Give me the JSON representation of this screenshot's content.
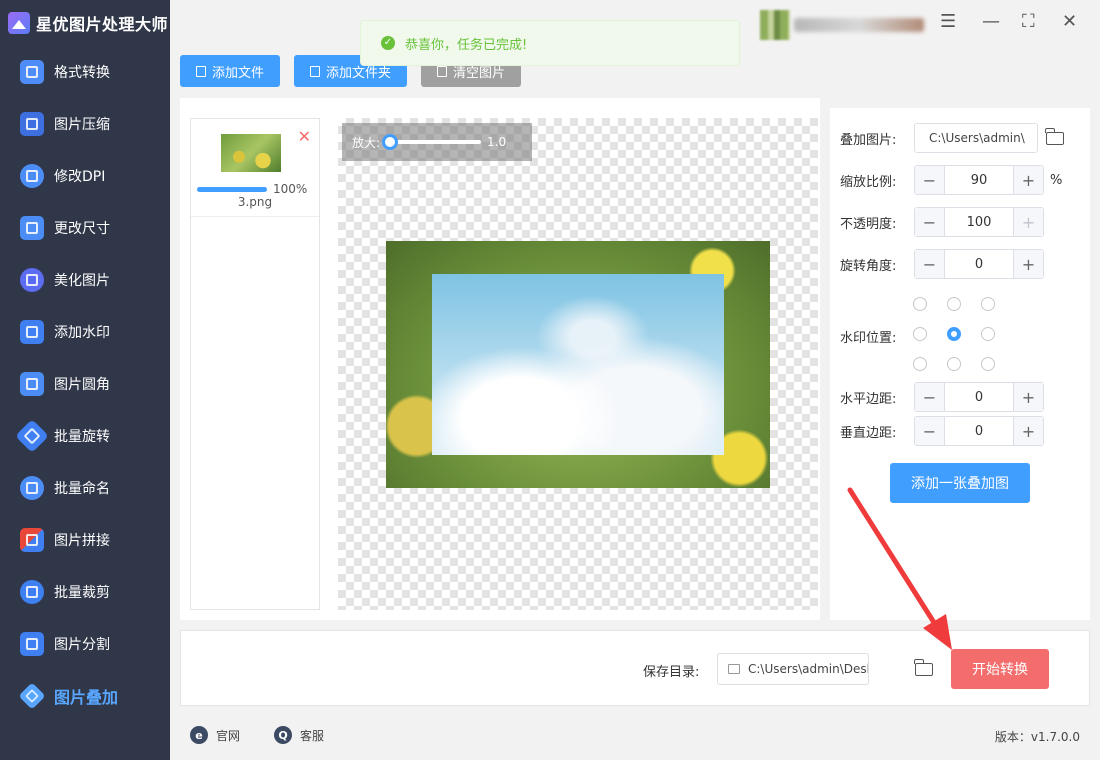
{
  "app": {
    "title": "星优图片处理大师"
  },
  "sidebar": {
    "items": [
      {
        "label": "格式转换",
        "icon": "image-convert-icon",
        "color": "#4f8cf7"
      },
      {
        "label": "图片压缩",
        "icon": "image-compress-icon",
        "color": "#3d6fe0"
      },
      {
        "label": "修改DPI",
        "icon": "dpi-icon",
        "color": "#4c8df5"
      },
      {
        "label": "更改尺寸",
        "icon": "resize-icon",
        "color": "#4c8df5"
      },
      {
        "label": "美化图片",
        "icon": "beautify-icon",
        "color": "#5b6cf0"
      },
      {
        "label": "添加水印",
        "icon": "watermark-icon",
        "color": "#3f7ff2"
      },
      {
        "label": "图片圆角",
        "icon": "rounded-corner-icon",
        "color": "#4c8df5"
      },
      {
        "label": "批量旋转",
        "icon": "rotate-icon",
        "color": "#3f7ff2"
      },
      {
        "label": "批量命名",
        "icon": "rename-icon",
        "color": "#4c8df5"
      },
      {
        "label": "图片拼接",
        "icon": "stitch-icon",
        "color": "#e8473a"
      },
      {
        "label": "批量裁剪",
        "icon": "crop-icon",
        "color": "#3f7ff2"
      },
      {
        "label": "图片分割",
        "icon": "split-icon",
        "color": "#3f7ff2"
      },
      {
        "label": "图片叠加",
        "icon": "layers-icon",
        "color": "#59a6ff",
        "active": true
      }
    ]
  },
  "toast": {
    "message": "恭喜你，任务已完成!"
  },
  "toolbar": {
    "add_file": "添加文件",
    "add_folder": "添加文件夹",
    "clear": "清空图片"
  },
  "file": {
    "name": "3.png",
    "progress_text": "100%",
    "progress": 1.0
  },
  "zoom": {
    "label": "放大:",
    "value": "1.0"
  },
  "settings": {
    "overlay_label": "叠加图片:",
    "overlay_path": "C:\\Users\\admin\\",
    "scale_label": "缩放比例:",
    "scale_value": "90",
    "scale_unit": "%",
    "opacity_label": "不透明度:",
    "opacity_value": "100",
    "rotation_label": "旋转角度:",
    "rotation_value": "0",
    "position_label": "水印位置:",
    "position_selected": "middle-center",
    "hmargin_label": "水平边距:",
    "hmargin_value": "0",
    "vmargin_label": "垂直边距:",
    "vmargin_value": "0",
    "add_overlay": "添加一张叠加图"
  },
  "bottom": {
    "save_label": "保存目录:",
    "save_path": "C:\\Users\\admin\\Deskto",
    "start": "开始转换"
  },
  "footer": {
    "website": "官网",
    "support": "客服",
    "version": "版本：v1.7.0.0"
  },
  "colors": {
    "accent": "#409eff",
    "start": "#f46d6d",
    "sidebar_bg": "#2f3749",
    "success": "#67c23a"
  }
}
